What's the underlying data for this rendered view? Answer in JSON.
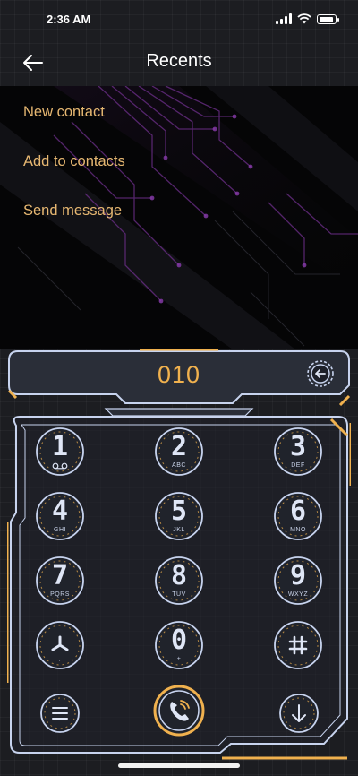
{
  "status_bar": {
    "time": "2:36 AM"
  },
  "header": {
    "title": "Recents"
  },
  "menu": {
    "items": [
      {
        "label": "New contact"
      },
      {
        "label": "Add to contacts"
      },
      {
        "label": "Send message"
      }
    ]
  },
  "dialer": {
    "number": "010",
    "keys": [
      {
        "digit": "1",
        "letters": ""
      },
      {
        "digit": "2",
        "letters": "ABC"
      },
      {
        "digit": "3",
        "letters": "DEF"
      },
      {
        "digit": "4",
        "letters": "GHI"
      },
      {
        "digit": "5",
        "letters": "JKL"
      },
      {
        "digit": "6",
        "letters": "MNO"
      },
      {
        "digit": "7",
        "letters": "PQRS"
      },
      {
        "digit": "8",
        "letters": "TUV"
      },
      {
        "digit": "9",
        "letters": "WXYZ"
      },
      {
        "digit": "",
        "letters": ","
      },
      {
        "digit": "0",
        "letters": "+"
      },
      {
        "digit": "",
        "letters": ""
      }
    ]
  },
  "icons": {
    "back": "arrow-left-icon",
    "delete": "backspace-icon",
    "voicemail": "voicemail-icon",
    "star": "asterisk-icon",
    "hash": "hash-icon",
    "menu": "menu-icon",
    "call": "phone-icon",
    "collapse": "arrow-down-icon"
  },
  "colors": {
    "accent_orange": "#f0b14e",
    "menu_text": "#e7b872",
    "frame_stroke": "#c7d3ee",
    "background": "#1c1d21"
  }
}
